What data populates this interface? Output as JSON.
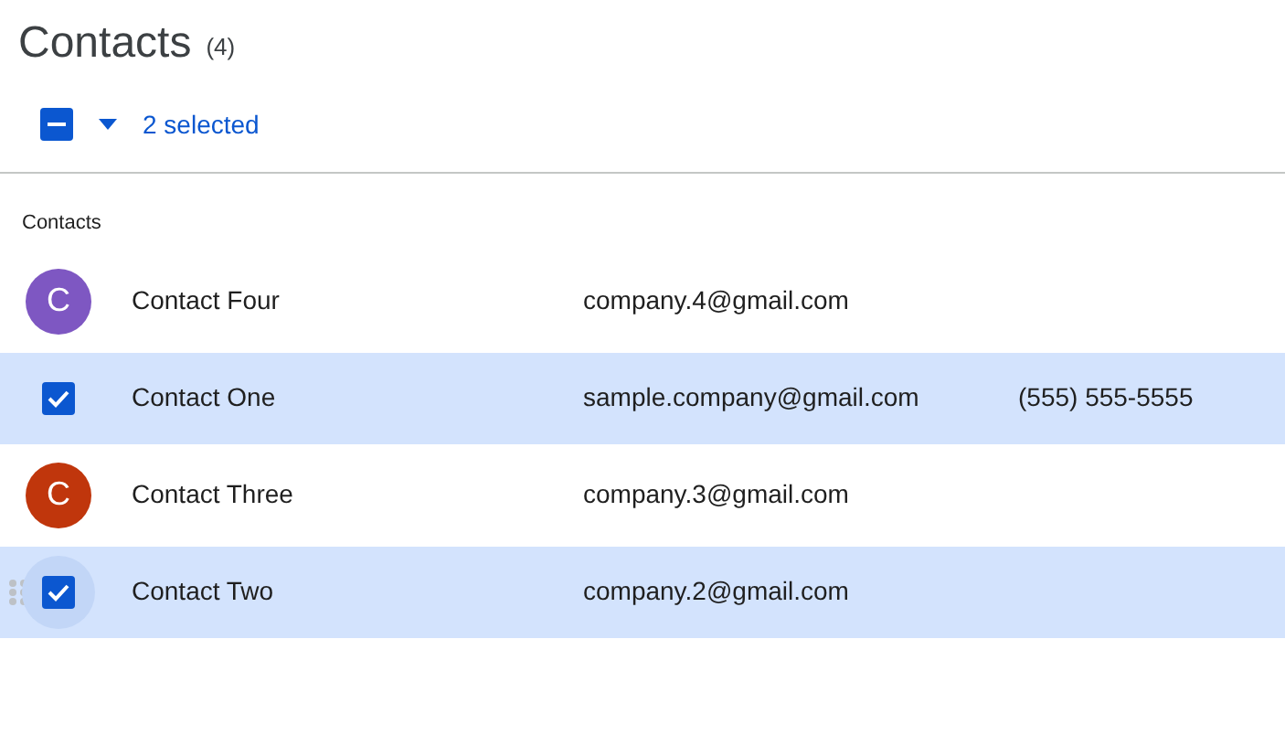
{
  "title": "Contacts",
  "count": "(4)",
  "selection": {
    "indeterminate": true,
    "label": "2 selected"
  },
  "section_label": "Contacts",
  "rows": [
    {
      "initial": "C",
      "color": "#7e57c2",
      "name": "Contact Four",
      "email": "company.4@gmail.com",
      "selected": false,
      "hovered": false
    },
    {
      "name": "Contact One",
      "email": "sample.company@gmail.com",
      "phone": "(555) 555-5555",
      "selected": true,
      "hovered": false
    },
    {
      "initial": "C",
      "color": "#c0360c",
      "name": "Contact Three",
      "email": "company.3@gmail.com",
      "selected": false,
      "hovered": false
    },
    {
      "name": "Contact Two",
      "email": "company.2@gmail.com",
      "selected": true,
      "hovered": true
    }
  ]
}
